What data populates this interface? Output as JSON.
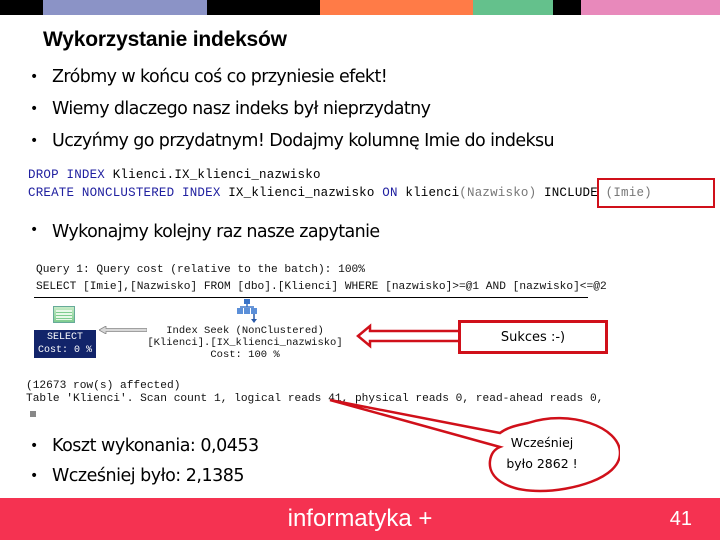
{
  "top_color_bar": [
    "#000000",
    "#8b93c6",
    "#000000",
    "#ff7b47",
    "#64c18c",
    "#000000",
    "#e889bb"
  ],
  "slide": {
    "title": "Wykorzystanie indeksów",
    "bullet_symbol": "•",
    "bullets": [
      "Zróbmy w końcu coś co przyniesie efekt!",
      "Wiemy dlaczego nasz indeks był nieprzydatny",
      "Uczyńmy go przydatnym! Dodajmy kolumnę Imie do indeksu"
    ],
    "sql": {
      "line1": {
        "kw1": "DROP INDEX ",
        "rest": "Klienci.IX_klienci_nazwisko"
      },
      "line2": {
        "kw1": "CREATE NONCLUSTERED INDEX ",
        "name": "IX_klienci_nazwisko ",
        "kw2": "ON ",
        "table": "klienci",
        "paren": "(Nazwisko) ",
        "include_kw": "INCLUDE ",
        "include_col": "(Imie)"
      }
    },
    "bullet_run_query": "Wykonajmy kolejny raz nasze zapytanie",
    "plan": {
      "header_line1": "Query 1: Query cost (relative to the batch): 100%",
      "header_line2": "SELECT [Imie],[Nazwisko] FROM [dbo].[Klienci] WHERE [nazwisko]>=@1 AND [nazwisko]<=@2",
      "select_node": {
        "label": "SELECT",
        "cost": "Cost: 0 %"
      },
      "seek_node": {
        "line1": "Index Seek (NonClustered)",
        "line2": "[Klienci].[IX_klienci_nazwisko]",
        "line3": "Cost: 100 %"
      }
    },
    "sukces_label": "Sukces :-)",
    "results": {
      "rows_affected": "(12673 row(s) affected)",
      "io_stats": "Table 'Klienci'. Scan count 1, logical reads 41, physical reads 0, read-ahead reads 0,"
    },
    "callout": {
      "line1": "Wcześniej",
      "line2": "było 2862 !"
    },
    "cost_bullets": [
      "Koszt wykonania: 0,0453",
      "Wcześniej było: 2,1385"
    ]
  },
  "footer": {
    "brand": "informatyka +",
    "page_number": "41",
    "color": "#f53251"
  }
}
